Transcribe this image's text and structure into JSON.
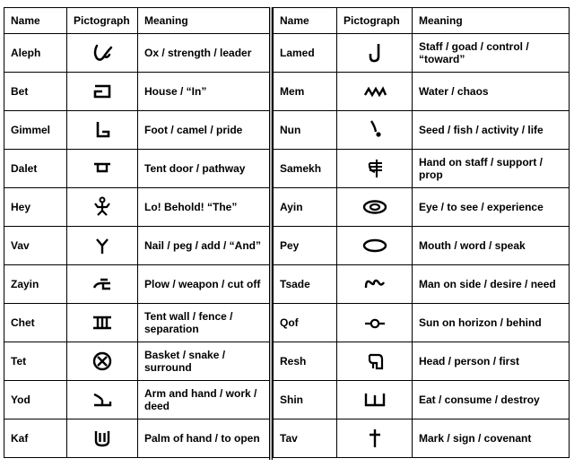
{
  "headers": {
    "name": "Name",
    "pictograph": "Pictograph",
    "meaning": "Meaning"
  },
  "left": [
    {
      "name": "Aleph",
      "icon": "ox-head-icon",
      "meaning": "Ox / strength / leader"
    },
    {
      "name": "Bet",
      "icon": "tent-floorplan-icon",
      "meaning": "House / “In”"
    },
    {
      "name": "Gimmel",
      "icon": "foot-icon",
      "meaning": "Foot / camel / pride"
    },
    {
      "name": "Dalet",
      "icon": "tent-door-icon",
      "meaning": "Tent door / pathway"
    },
    {
      "name": "Hey",
      "icon": "man-raised-arms-icon",
      "meaning": "Lo!  Behold! “The”"
    },
    {
      "name": "Vav",
      "icon": "tent-peg-icon",
      "meaning": "Nail / peg / add / “And”"
    },
    {
      "name": "Zayin",
      "icon": "plow-icon",
      "meaning": "Plow / weapon / cut off"
    },
    {
      "name": "Chet",
      "icon": "tent-wall-icon",
      "meaning": "Tent wall / fence / separation"
    },
    {
      "name": "Tet",
      "icon": "basket-icon",
      "meaning": "Basket / snake / surround"
    },
    {
      "name": "Yod",
      "icon": "arm-hand-icon",
      "meaning": "Arm and hand / work / deed"
    },
    {
      "name": "Kaf",
      "icon": "palm-icon",
      "meaning": "Palm of hand / to open"
    }
  ],
  "right": [
    {
      "name": "Lamed",
      "icon": "staff-icon",
      "meaning": "Staff / goad / control / “toward”"
    },
    {
      "name": "Mem",
      "icon": "water-icon",
      "meaning": "Water / chaos"
    },
    {
      "name": "Nun",
      "icon": "seed-icon",
      "meaning": "Seed / fish / activity / life"
    },
    {
      "name": "Samekh",
      "icon": "hand-on-staff-icon",
      "meaning": "Hand on staff / support / prop"
    },
    {
      "name": "Ayin",
      "icon": "eye-icon",
      "meaning": "Eye / to see / experience"
    },
    {
      "name": "Pey",
      "icon": "mouth-icon",
      "meaning": "Mouth / word / speak"
    },
    {
      "name": "Tsade",
      "icon": "man-on-side-icon",
      "meaning": "Man on side / desire / need"
    },
    {
      "name": "Qof",
      "icon": "sun-horizon-icon",
      "meaning": "Sun on horizon / behind"
    },
    {
      "name": "Resh",
      "icon": "head-icon",
      "meaning": "Head / person / first"
    },
    {
      "name": "Shin",
      "icon": "teeth-icon",
      "meaning": "Eat / consume / destroy"
    },
    {
      "name": "Tav",
      "icon": "cross-mark-icon",
      "meaning": "Mark / sign / covenant"
    }
  ]
}
